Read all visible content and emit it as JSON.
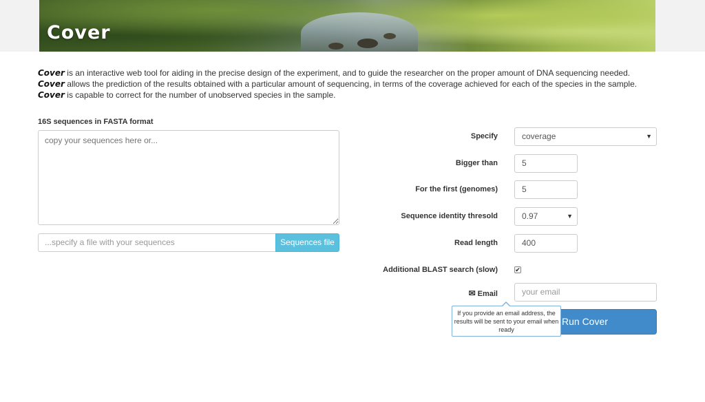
{
  "app": {
    "title": "Cover"
  },
  "description": {
    "brand": "Cover",
    "part1": " is an interactive web tool for aiding in the precise design of the experiment, and to guide the researcher on the proper amount of DNA sequencing needed. ",
    "part2": " allows the prediction of the results obtained with a particular amount of sequencing, in terms of the coverage achieved for each of the species in the sample. ",
    "part3": " is capable to correct for the number of unobserved species in the sample."
  },
  "sequences": {
    "label": "16S sequences in FASTA format",
    "textarea_placeholder": "copy your sequences here or...",
    "file_placeholder": "...specify a file with your sequences",
    "file_button": "Sequences file"
  },
  "form": {
    "specify": {
      "label": "Specify",
      "value": "coverage"
    },
    "bigger_than": {
      "label": "Bigger than",
      "value": "5"
    },
    "first_genomes": {
      "label": "For the first (genomes)",
      "value": "5"
    },
    "identity": {
      "label": "Sequence identity thresold",
      "value": "0.97"
    },
    "read_length": {
      "label": "Read length",
      "value": "400"
    },
    "blast": {
      "label": "Additional BLAST search (slow)",
      "checked": true
    },
    "email": {
      "label": "Email",
      "placeholder": "your email",
      "icon": "envelope-icon"
    },
    "run_button": "Run Cover",
    "tooltip": "If you provide an email address, the results will be sent to your email when ready"
  },
  "colors": {
    "primary": "#428bca",
    "info": "#5bc0de",
    "tooltip_border": "#7fb1dd"
  }
}
